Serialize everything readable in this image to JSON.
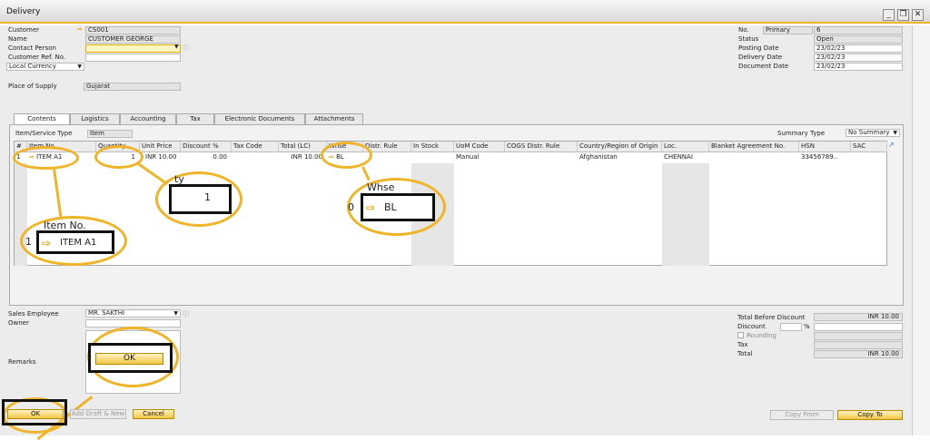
{
  "window": {
    "title": "Delivery",
    "minimize": "_",
    "restore": "❐",
    "close": "✕"
  },
  "header_left": {
    "customer_label": "Customer",
    "customer_value": "CS001",
    "name_label": "Name",
    "name_value": "CUSTOMER GEORGE",
    "contact_label": "Contact Person",
    "contact_value": "",
    "ref_label": "Customer Ref. No.",
    "ref_value": "",
    "currency_label": "Local Currency",
    "supply_label": "Place of Supply",
    "supply_value": "Gujarat"
  },
  "header_right": {
    "no_label": "No.",
    "series_value": "Primary",
    "no_value": "6",
    "status_label": "Status",
    "status_value": "Open",
    "posting_label": "Posting Date",
    "posting_value": "23/02/23",
    "delivery_label": "Delivery Date",
    "delivery_value": "23/02/23",
    "document_label": "Document Date",
    "document_value": "23/02/23"
  },
  "tabs": [
    "Contents",
    "Logistics",
    "Accounting",
    "Tax",
    "Electronic Documents",
    "Attachments"
  ],
  "contents": {
    "type_label": "Item/Service Type",
    "type_value": "Item",
    "summary_label": "Summary Type",
    "summary_value": "No Summary"
  },
  "grid": {
    "columns": [
      "#",
      "Item No.",
      "Quantity",
      "Unit Price",
      "Discount %",
      "Tax Code",
      "Total (LC)",
      "Whse",
      "Distr. Rule",
      "In Stock",
      "UoM Code",
      "COGS Distr. Rule",
      "Country/Region of Origin",
      "Loc.",
      "Blanket Agreement No.",
      "HSN",
      "SAC"
    ],
    "row": {
      "num": "1",
      "item": "ITEM A1",
      "qty": "1",
      "price": "INR 10.00",
      "discount": "0.00",
      "total": "INR 10.00",
      "whse": "BL",
      "uom": "Manual",
      "country": "Afghanistan",
      "loc": "CHENNAI",
      "hsn": "33456789.."
    }
  },
  "zoom": {
    "qty_label": "ty",
    "qty_value": "1",
    "whse_label": "Whse",
    "whse_prefix": "0",
    "whse_value": "BL",
    "item_label": "Item No.",
    "item_row": "1",
    "item_value": "ITEM A1",
    "ok_label": "OK"
  },
  "footer_left": {
    "sales_label": "Sales Employee",
    "sales_value": "MR. SAKTHI",
    "owner_label": "Owner",
    "owner_value": "",
    "remarks_label": "Remarks"
  },
  "footer_right": {
    "before_label": "Total Before Discount",
    "before_value": "INR 10.00",
    "discount_label": "Discount",
    "percent": "%",
    "rounding_label": "Rounding",
    "tax_label": "Tax",
    "total_label": "Total",
    "total_value": "INR 10.00"
  },
  "buttons": {
    "ok": "OK",
    "add_draft": "Add Draft & New",
    "cancel": "Cancel",
    "copy_from": "Copy From",
    "copy_to": "Copy To"
  },
  "colors": {
    "accent": "#f0b429",
    "field_readonly": "#e4e4e4",
    "window_bg": "#ececec"
  }
}
